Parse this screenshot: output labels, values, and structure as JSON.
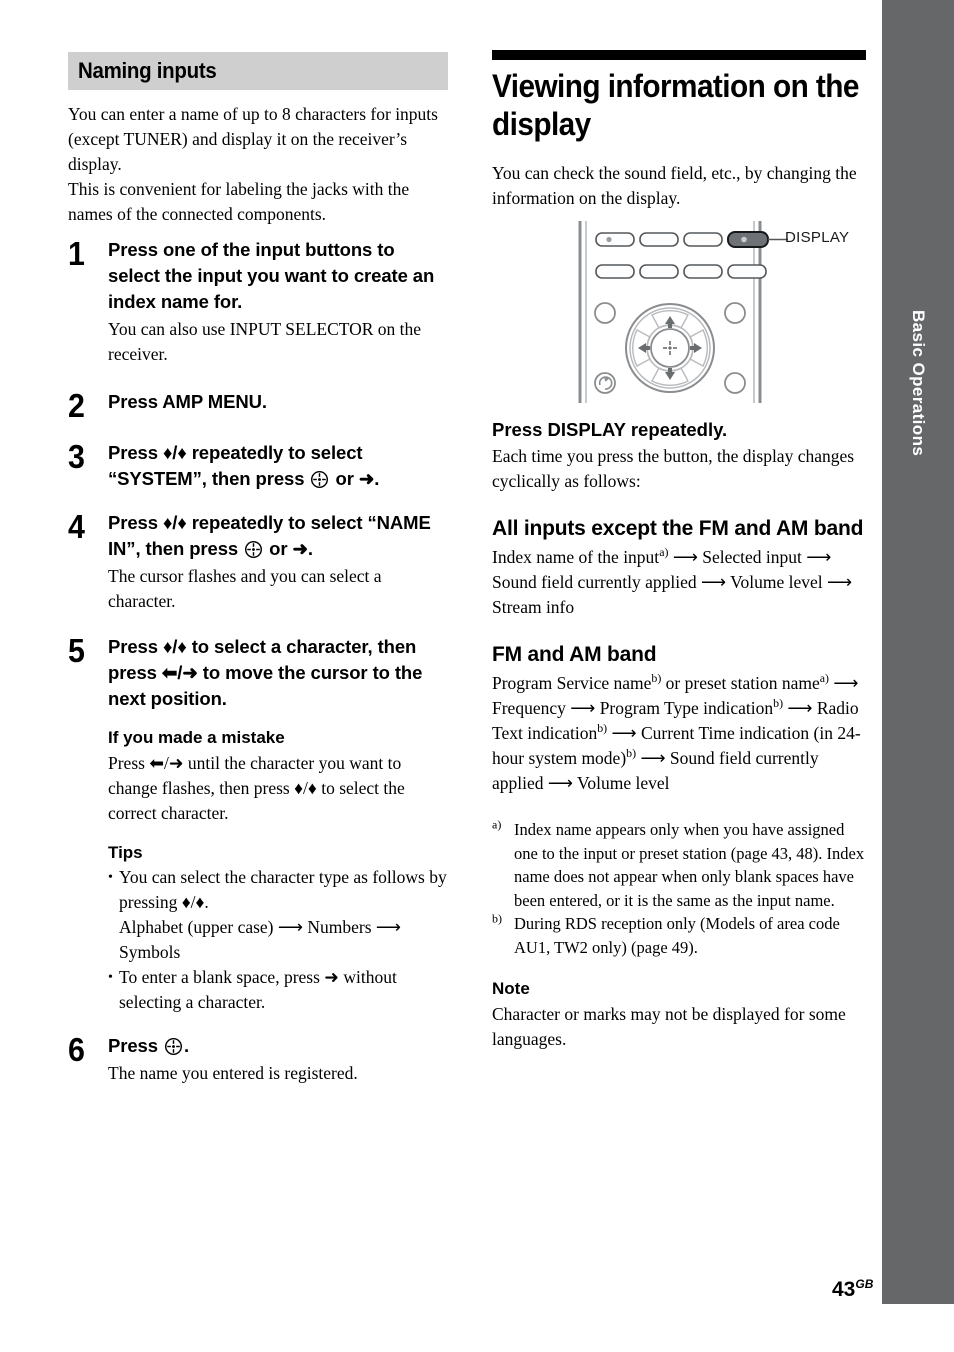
{
  "page": {
    "number": "43",
    "number_sup": "GB",
    "side_tab": "Basic Operations"
  },
  "left_column": {
    "section_heading": "Naming inputs",
    "intro": [
      "You can enter a name of up to 8 characters for inputs (except TUNER) and display it on the receiver’s display.",
      "This is convenient for labeling the jacks with the names of the connected components."
    ],
    "steps": [
      {
        "num": "1",
        "title": "Press one of the input buttons to select the input you want to create an index name for.",
        "note": "You can also use INPUT SELECTOR on the receiver."
      },
      {
        "num": "2",
        "title": "Press AMP MENU.",
        "note": ""
      },
      {
        "num": "3",
        "title_pre": "Press ♦/♦ repeatedly to select “SYSTEM”, then press ",
        "title_post": " or ➜.",
        "note": ""
      },
      {
        "num": "4",
        "title_pre": "Press ♦/♦ repeatedly to select “NAME IN”, then press ",
        "title_post": " or ➜.",
        "note": "The cursor flashes and you can select a character."
      },
      {
        "num": "5",
        "title": "Press ♦/♦ to select a character, then press ⬅/➜ to move the cursor to the next position.",
        "note": ""
      },
      {
        "num": "6",
        "title_pre": "Press ",
        "title_post": ".",
        "note": "The name you entered is registered."
      }
    ],
    "mistake": {
      "heading": "If you made a mistake",
      "body": "Press ⬅/➜ until the character you want to change flashes, then press ♦/♦ to select the correct character."
    },
    "tips": {
      "heading": "Tips",
      "items": [
        "You can select the character type as follows by pressing ♦/♦.",
        "To enter a blank space, press ➜ without selecting a character."
      ],
      "cycle": "Alphabet (upper case) ⟶ Numbers ⟶ Symbols"
    }
  },
  "right_column": {
    "chapter_title": "Viewing information on the display",
    "intro": "You can check the sound field, etc., by changing the information on the display.",
    "callout_label": "DISPLAY",
    "instruction": "Press DISPLAY repeatedly.",
    "instruction_note": "Each time you press the button, the display changes cyclically as follows:",
    "section_all_inputs": {
      "heading": "All inputs except the FM and AM band",
      "body_parts": [
        "Index name of the input",
        "a)",
        " ⟶ Selected input ⟶ Sound field currently applied ⟶ Volume level ⟶ Stream info"
      ]
    },
    "section_fm_am": {
      "heading": "FM and AM band",
      "p1": "Program Service name",
      "s1": "b)",
      "p2": " or preset station name",
      "s2": "a)",
      "p3": " ⟶ Frequency ⟶ Program Type indication",
      "s3": "b)",
      "p4": " ⟶ Radio Text indication",
      "s4": "b)",
      "p5": " ⟶ Current Time indication (in 24-hour system mode)",
      "s5": "b)",
      "p6": " ⟶ Sound field currently applied ⟶ Volume level"
    },
    "footnotes": [
      {
        "marker": "a)",
        "text": "Index name appears only when you have assigned one to the input or preset station (page 43, 48). Index name does not appear when only blank spaces have been entered, or it is the same as the input name."
      },
      {
        "marker": "b)",
        "text": "During RDS reception only (Models of area code AU1, TW2 only) (page 49)."
      }
    ],
    "note": {
      "heading": "Note",
      "text": "Character or marks may not be displayed for some languages."
    }
  },
  "colors": {
    "side_band": "#666768",
    "gray_heading_bar": "#cfcfcf",
    "black_bar": "#000000",
    "remote_outline": "#7a7d80",
    "display_button_fill": "#6e7175"
  }
}
